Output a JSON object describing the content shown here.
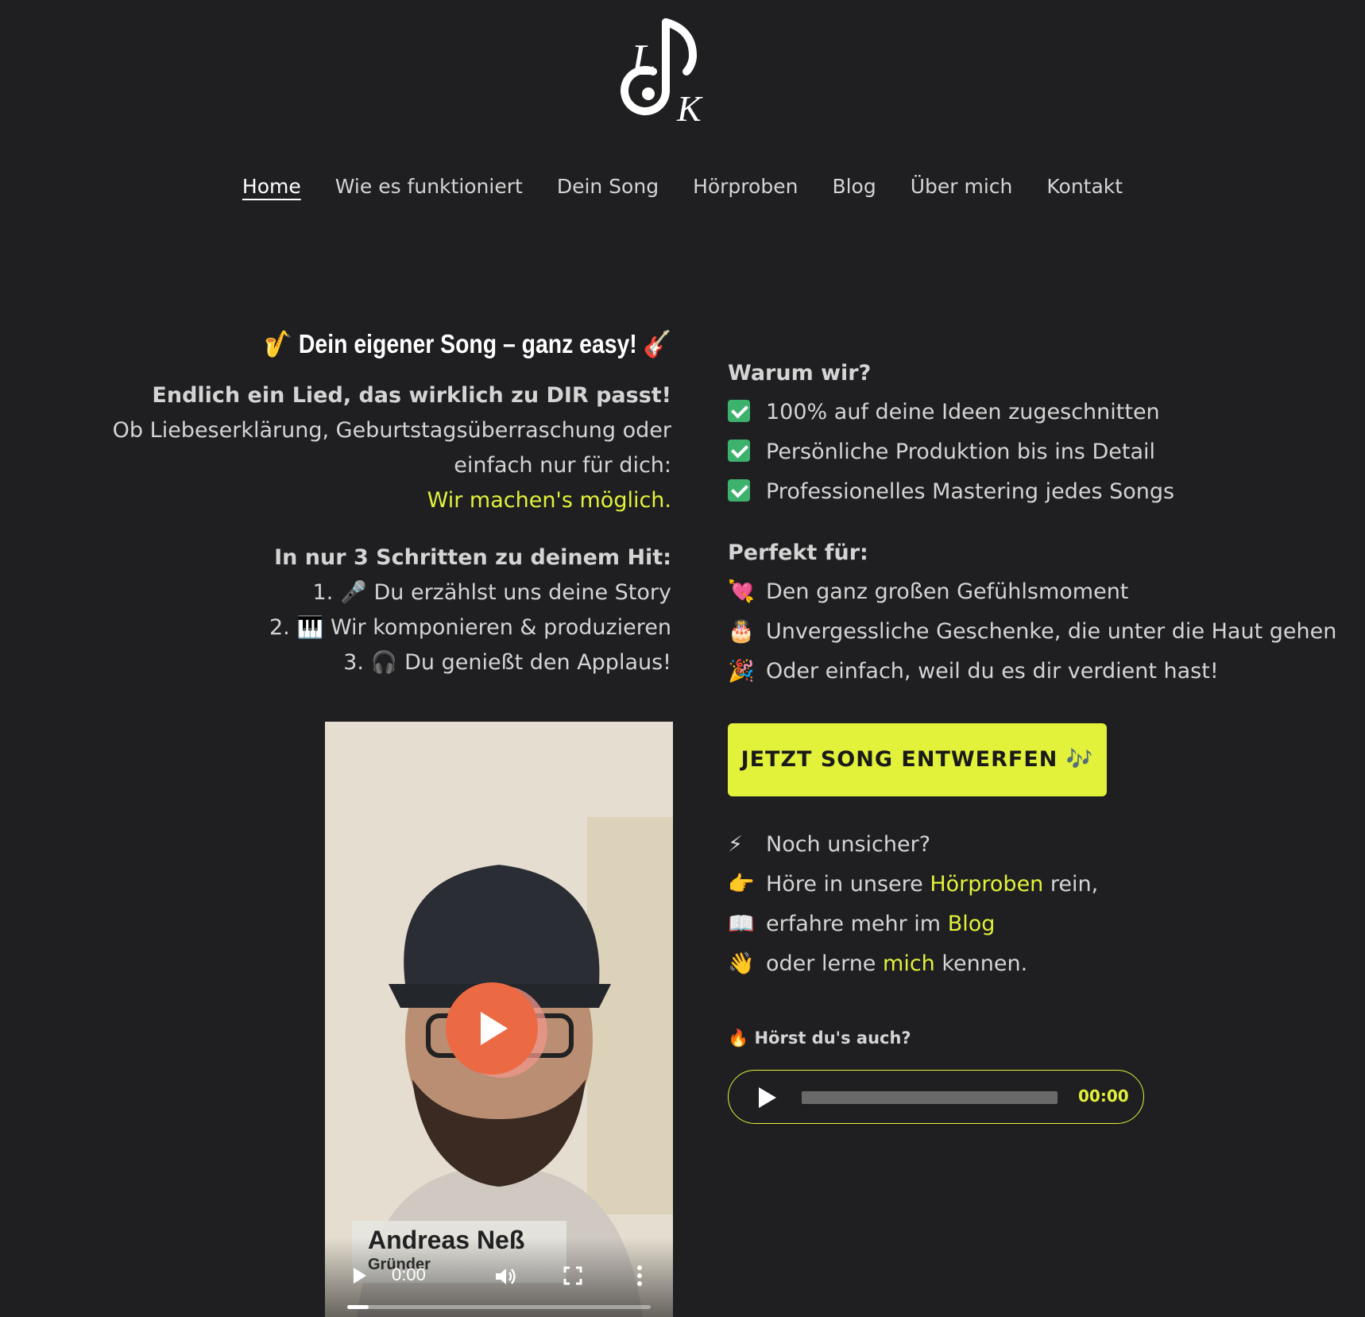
{
  "colors": {
    "background": "#1f1f22",
    "accent": "#e2f13a",
    "text": "#d4d4d4",
    "check_green": "#3db26d",
    "play_orange": "#ec6a43"
  },
  "nav": {
    "items": [
      {
        "label": "Home",
        "active": true
      },
      {
        "label": "Wie es funktioniert"
      },
      {
        "label": "Dein Song"
      },
      {
        "label": "Hörproben"
      },
      {
        "label": "Blog"
      },
      {
        "label": "Über mich"
      },
      {
        "label": "Kontakt"
      }
    ]
  },
  "hero": {
    "headline_emoji_left": "🎷",
    "headline": "Dein eigener Song – ganz easy!",
    "headline_emoji_right": "🎸",
    "lead_bold": "Endlich ein Lied, das wirklich zu DIR passt!",
    "lead_line1": "Ob Liebeserklärung, Geburtstagsüberraschung oder",
    "lead_line2": "einfach nur für dich:",
    "lead_accent": "Wir machen's möglich.",
    "steps_title": "In nur 3 Schritten zu deinem Hit:",
    "steps": [
      {
        "num": "1.",
        "emoji": "🎤",
        "text": "Du erzählst uns deine Story"
      },
      {
        "num": "2.",
        "emoji": "🎹",
        "text": "Wir komponieren & produzieren"
      },
      {
        "num": "3.",
        "emoji": "🎧",
        "text": "Du genießt den Applaus!"
      }
    ]
  },
  "video": {
    "name": "Andreas Neß",
    "role": "Gründer",
    "time": "0:00",
    "progress": 0.07
  },
  "why": {
    "title": "Warum wir?",
    "items": [
      "100% auf deine Ideen zugeschnitten",
      "Persönliche Produktion bis ins Detail",
      "Professionelles Mastering jedes Songs"
    ]
  },
  "perfect": {
    "title": "Perfekt für:",
    "items": [
      {
        "emoji": "💘",
        "text": "Den ganz großen Gefühlsmoment"
      },
      {
        "emoji": "🎂",
        "text": "Unvergessliche Geschenke, die unter die Haut gehen"
      },
      {
        "emoji": "🎉",
        "text": "Oder einfach, weil du es dir verdient hast!"
      }
    ]
  },
  "cta": {
    "label": "JETZT SONG ENTWERFEN",
    "emoji": "🎶"
  },
  "more": {
    "line1_emoji": "⚡",
    "line1": "Noch unsicher?",
    "line2_emoji": "👉",
    "line2_pre": "Höre in unsere",
    "line2_link": "Hörproben",
    "line2_post": "rein,",
    "line3_emoji": "📖",
    "line3_pre": "erfahre mehr im",
    "line3_link": "Blog",
    "line4_emoji": "👋",
    "line4_pre": "oder lerne",
    "line4_link": "mich",
    "line4_post": "kennen."
  },
  "audio": {
    "title_emoji": "🔥",
    "title": "Hörst du's auch?",
    "time": "00:00"
  }
}
